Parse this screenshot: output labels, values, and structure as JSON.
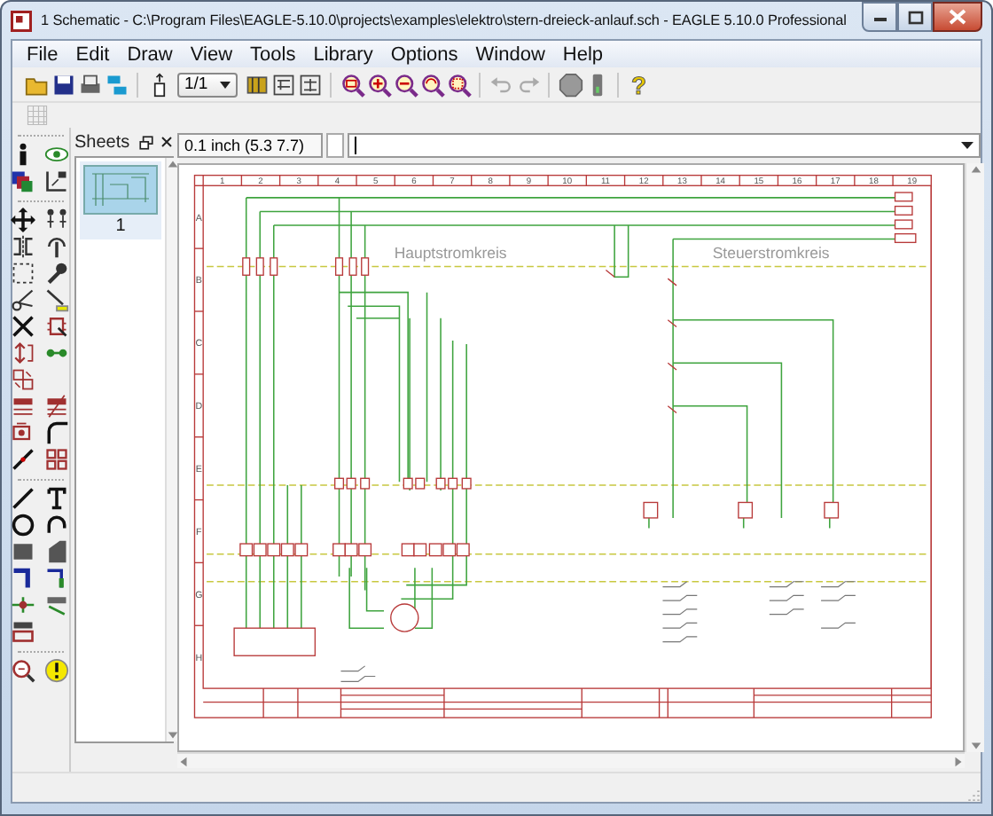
{
  "window": {
    "title": "1 Schematic - C:\\Program Files\\EAGLE-5.10.0\\projects\\examples\\elektro\\stern-dreieck-anlauf.sch - EAGLE 5.10.0 Professional"
  },
  "menu": [
    "File",
    "Edit",
    "Draw",
    "View",
    "Tools",
    "Library",
    "Options",
    "Window",
    "Help"
  ],
  "toolbar": {
    "zoom_select": "1/1",
    "help": "?"
  },
  "command_bar": {
    "coordinates": "0.1 inch (5.3 7.7)"
  },
  "sheets_panel": {
    "title": "Sheets",
    "sheets": [
      {
        "label": "1",
        "selected": true
      }
    ]
  },
  "schematic": {
    "columns": [
      "1",
      "2",
      "3",
      "4",
      "5",
      "6",
      "7",
      "8",
      "9",
      "10",
      "11",
      "12",
      "13",
      "14",
      "15",
      "16",
      "17",
      "18",
      "19"
    ],
    "rows": [
      "A",
      "B",
      "C",
      "D",
      "E",
      "F",
      "G",
      "H"
    ],
    "labels": [
      "Hauptstromkreis",
      "Steuerstromkreis"
    ]
  }
}
